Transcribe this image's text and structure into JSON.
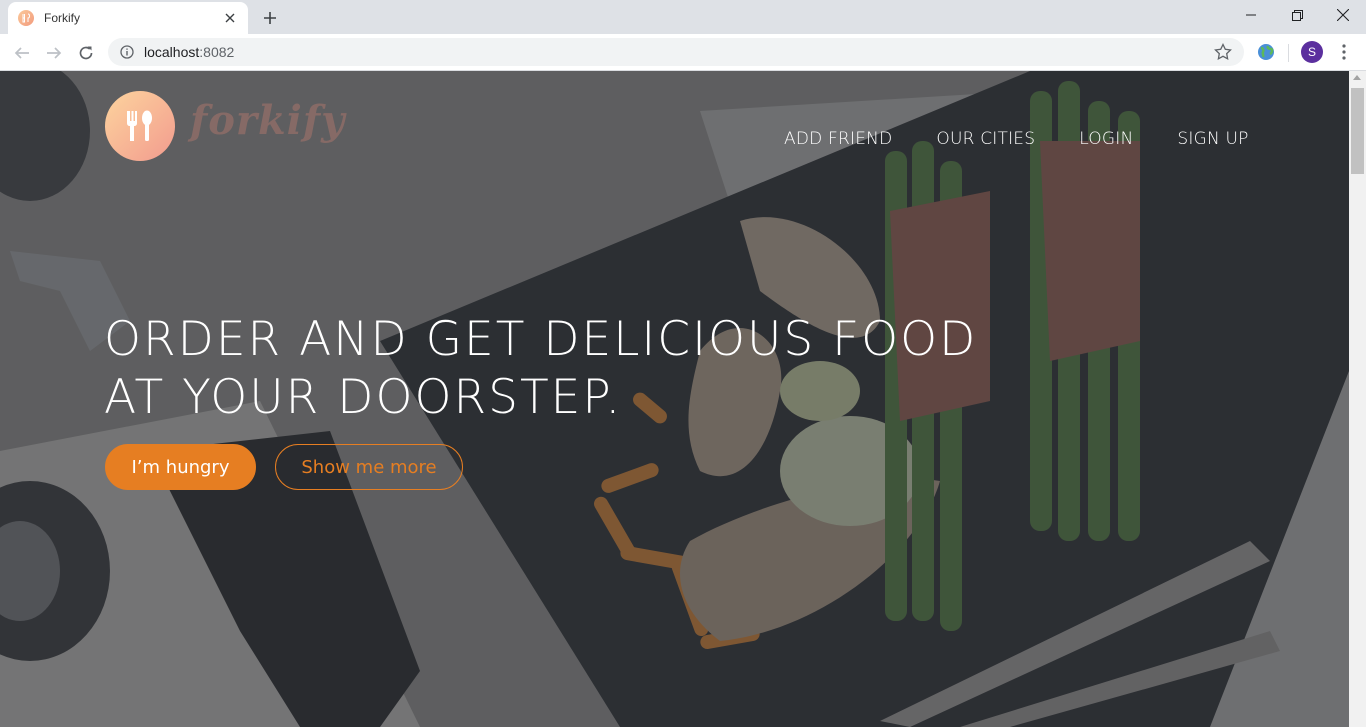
{
  "browser": {
    "tab_title": "Forkify",
    "url_host": "localhost",
    "url_port": ":8082",
    "profile_initial": "S"
  },
  "site": {
    "logo_text": "forkify",
    "nav": [
      {
        "label": "ADD FRIEND"
      },
      {
        "label": "OUR CITIES"
      },
      {
        "label": "LOGIN"
      },
      {
        "label": "SIGN UP"
      }
    ],
    "headline_line1": "ORDER AND GET DELICIOUS FOOD",
    "headline_line2": "AT YOUR DOORSTEP.",
    "primary_button": "I’m hungry",
    "secondary_button": "Show me more"
  },
  "colors": {
    "accent": "#e67e22",
    "logo_gradient_start": "#fdd49e",
    "logo_gradient_end": "#f29b8e",
    "overlay": "rgba(55,58,64,0.62)"
  },
  "icons": {
    "logo": "fork-knife-icon",
    "back": "back-arrow-icon",
    "forward": "forward-arrow-icon",
    "reload": "reload-icon",
    "info": "info-icon",
    "bookmark": "star-icon",
    "extension": "globe-extension-icon",
    "menu": "kebab-menu-icon"
  }
}
